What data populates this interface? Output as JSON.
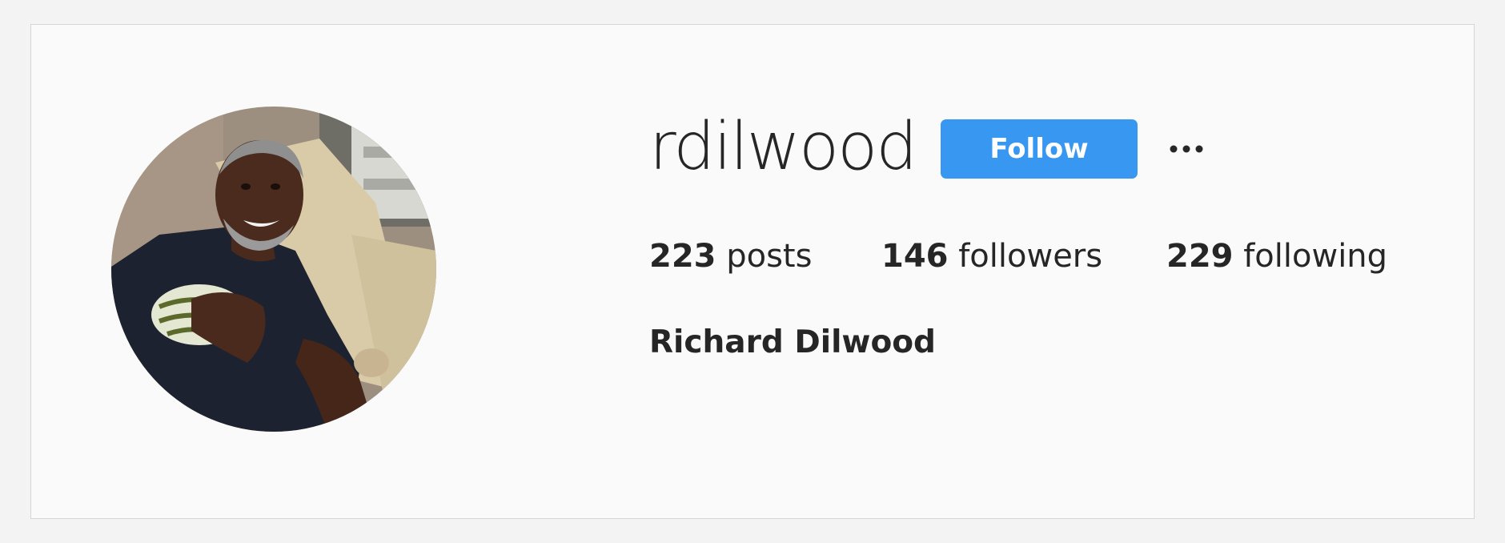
{
  "profile": {
    "username": "rdilwood",
    "full_name": "Richard Dilwood",
    "avatar_alt": "rdilwood's profile picture"
  },
  "actions": {
    "follow_label": "Follow",
    "more_icon": "ellipsis-icon"
  },
  "stats": {
    "posts": {
      "count": "223",
      "label": "posts"
    },
    "followers": {
      "count": "146",
      "label": "followers"
    },
    "following": {
      "count": "229",
      "label": "following"
    }
  },
  "colors": {
    "accent": "#3897f0",
    "text": "#262626",
    "background": "#fafafa"
  }
}
